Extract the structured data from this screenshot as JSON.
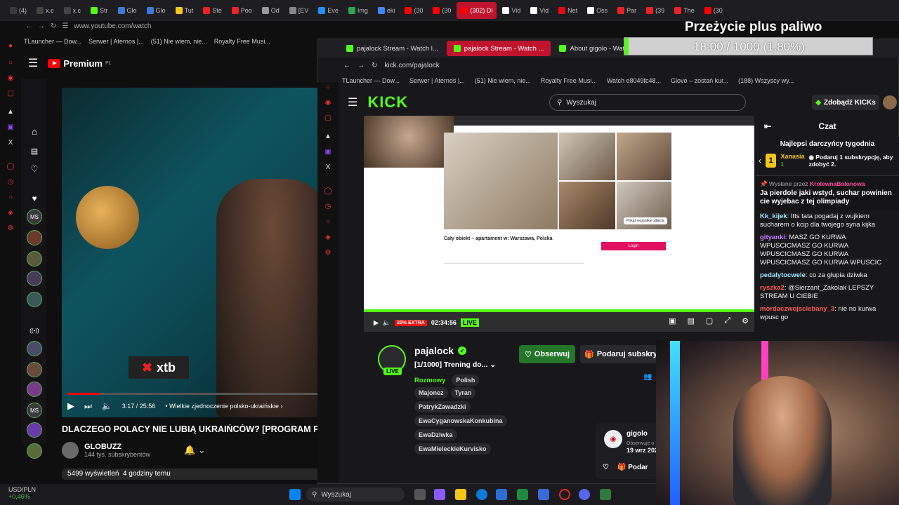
{
  "browser_tabs": [
    "(4)",
    "x.c",
    "x.c",
    "Str",
    "Glo",
    "Glo",
    "Tut",
    "Ste",
    "Poo",
    "Od",
    "[EV",
    "Eve",
    "Img",
    "eki",
    "(30",
    "(30",
    "(302) Dl",
    "Vid",
    "Vid",
    "Net",
    "Oss",
    "Par",
    "(39",
    "The",
    "(30"
  ],
  "yt_window": {
    "url": "www.youtube.com/watch",
    "bookmarks": [
      "TLauncher — Dow...",
      "Serwer | Aternos |...",
      "(51) Nie wiem, nie...",
      "Royalty Free Musi..."
    ],
    "logo": "Premium",
    "logo_suffix": "PL",
    "overlay_brand": "xtb",
    "time": "3:17 / 25:56",
    "chapter": "Wielkie zjednoczenie polsko-ukraińskie",
    "progress": 0.128,
    "title": "DLACZEGO POLACY NIE LUBIĄ UKRAIŃCÓW? [PROGRAM PR",
    "channel": "GLOBUZZ",
    "subs": "144 tys. subskrybentów",
    "views": "5499 wyświetleń",
    "age": "4 godziny temu"
  },
  "kick_window": {
    "tabs": [
      "pajalock Stream - Watch l...",
      "pajalock Stream - Watch ...",
      "About gigolo - Watch Live..."
    ],
    "url": "kick.com/pajalock",
    "bookmarks": [
      "TLauncher — Dow...",
      "Serwer | Aternos |...",
      "(51) Nie wiem, nie...",
      "Royalty Free Musi...",
      "Watch e8049fc48...",
      "Glovo – zostań kur...",
      "(188) Wszyscy wy..."
    ],
    "logo": "KICK",
    "search_placeholder": "Wyszukaj",
    "kicks_button": "Zdobądź KICKs",
    "stream_time": "02:34:56",
    "live_label": "LIVE",
    "extra_badge": "20% EXTRA",
    "stream_listing": "Cały obiekt – apartament w: Warszawa, Polska",
    "stream_login": "Login",
    "stream_photos": "Pokaż wszystkie zdjęcia",
    "streamer": "pajalock",
    "stream_title": "[1/1000] Trening do...",
    "category": "Rozmowy",
    "language": "Polish",
    "tags": [
      "Majonez",
      "Tyran",
      "PatrykZawadzki",
      "EwaCyganowskaKonkubina",
      "EwaDziwka",
      "EwaMieleckieKurvisko"
    ],
    "follow": "Obserwuj",
    "subscribe": "Podaruj subskrypcję",
    "side_initials": [
      "MS",
      "MS"
    ],
    "gigolo_name": "gigolo",
    "gigolo_sub": "Obserwuje o",
    "gigolo_date": "19 wrz 202",
    "gigolo_button": "Podar"
  },
  "chat": {
    "title": "Czat",
    "top_header": "Najlepsi darczyńcy tygodnia",
    "top_name": "Xanasia",
    "top_count": "1",
    "top_gift": "Podaruj 1 subskrypcję, aby zdobyć 2.",
    "pinned_by": "Wysłane przez",
    "pinned_user": "KrolewnaBalonowa",
    "pinned_msg": "Ja pierdole jaki wstyd, suchar powinien cie wyjebac z tej olimpiady",
    "messages": [
      {
        "user": "Kk_kijek",
        "text": "Itts tata pogadaj z wujkiem sucharem o kcip dla twojego syna kijka",
        "color": "#9be8ff"
      },
      {
        "user": "gityanki",
        "text": "MASZ GO KURWA WPUSCICMASZ GO KURWA WPUSCICMASZ GO KURWA WPUSCICMASZ GO KURWA WPUSCIC",
        "color": "#c77dff"
      },
      {
        "user": "pedalytocwele",
        "text": "co za głupia dziwka",
        "color": "#9be8ff"
      },
      {
        "user": "ryszka2",
        "text": "@Sierzant_Zakolak LEPSZY STREAM U CIEBIE",
        "color": "#ff5a5a"
      },
      {
        "user": "mordaczwojsciebany_3",
        "text": "nie no kurwa wpusc go",
        "color": "#ff5a5a"
      }
    ]
  },
  "overlay": {
    "title": "Przeżycie plus paliwo",
    "progress_text": "18.00 / 1000 (1.80%)",
    "progress": 0.018
  },
  "taskbar": {
    "weather_label": "USD/PLN",
    "weather_change": "+0,46%",
    "search": "Wyszukaj"
  },
  "colors": {
    "kick_green": "#53fc18",
    "youtube_red": "#ff0000",
    "active_tab": "#c0142e"
  }
}
